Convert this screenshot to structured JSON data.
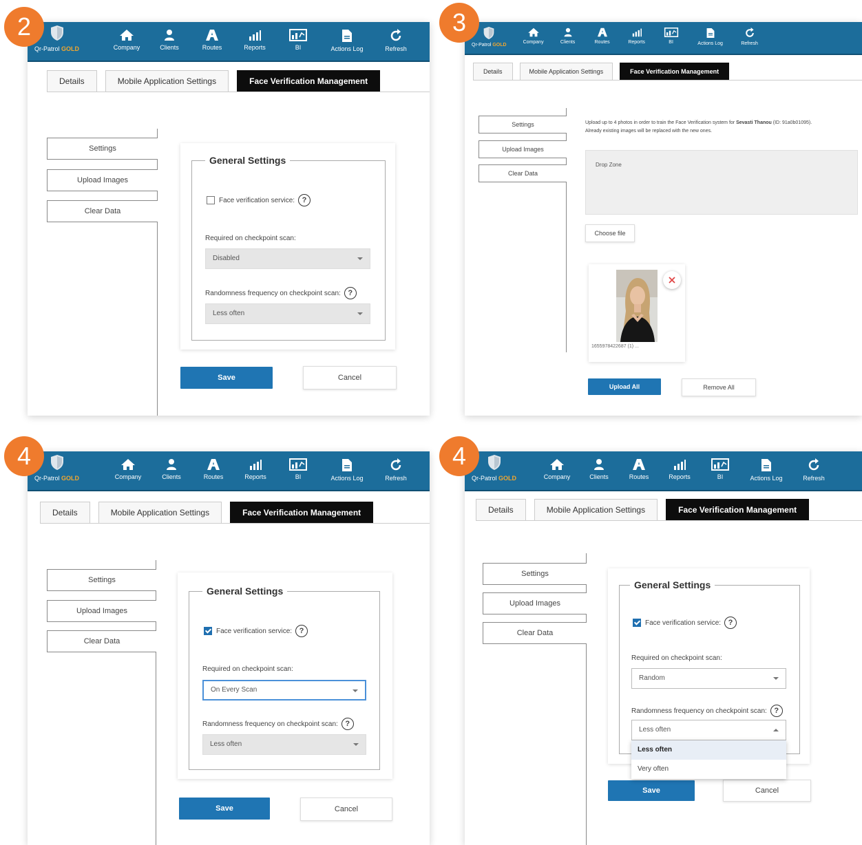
{
  "app": {
    "brand_name": "Qr-Patrol",
    "brand_tier": "GOLD",
    "nav": [
      {
        "label": "Company",
        "icon": "home-icon"
      },
      {
        "label": "Clients",
        "icon": "user-icon"
      },
      {
        "label": "Routes",
        "icon": "routes-icon"
      },
      {
        "label": "Reports",
        "icon": "reports-icon"
      },
      {
        "label": "BI",
        "icon": "bi-icon"
      },
      {
        "label": "Actions Log",
        "icon": "document-icon"
      },
      {
        "label": "Refresh",
        "icon": "refresh-icon"
      }
    ],
    "tabs": [
      "Details",
      "Mobile Application Settings",
      "Face Verification Management"
    ],
    "sidebar": [
      "Settings",
      "Upload Images",
      "Clear Data"
    ]
  },
  "steps": [
    "2",
    "3",
    "4",
    "4"
  ],
  "colors": {
    "step_badge": "#ef7b2d",
    "navbar": "#1c6d9b",
    "primary": "#1f75b3",
    "tier": "#f2a72e"
  },
  "settings": {
    "title": "General Settings",
    "face_label": "Face verification service:",
    "required_label": "Required on checkpoint scan:",
    "random_label": "Randomness frequency on checkpoint scan:",
    "save": "Save",
    "cancel": "Cancel"
  },
  "panel2": {
    "face_checked": false,
    "required_value": "Disabled",
    "random_value": "Less often"
  },
  "panel4a": {
    "face_checked": true,
    "required_value": "On Every Scan",
    "random_value": "Less often"
  },
  "panel4b": {
    "face_checked": true,
    "required_value": "Random",
    "random_value": "Less often",
    "options": [
      "Less often",
      "Very often"
    ]
  },
  "upload": {
    "intro_prefix": "Upload up to 4 photos in order to train the Face Verification system for ",
    "user_name": "Sevasti Thanou",
    "id_text": " (ID: 91a0b01095).",
    "intro_line2": "Already existing images will be replaced with the new ones.",
    "drop_zone": "Drop Zone",
    "choose_file": "Choose file",
    "file_name": "1655978422687 (1) ...",
    "upload_all": "Upload All",
    "remove_all": "Remove All"
  }
}
